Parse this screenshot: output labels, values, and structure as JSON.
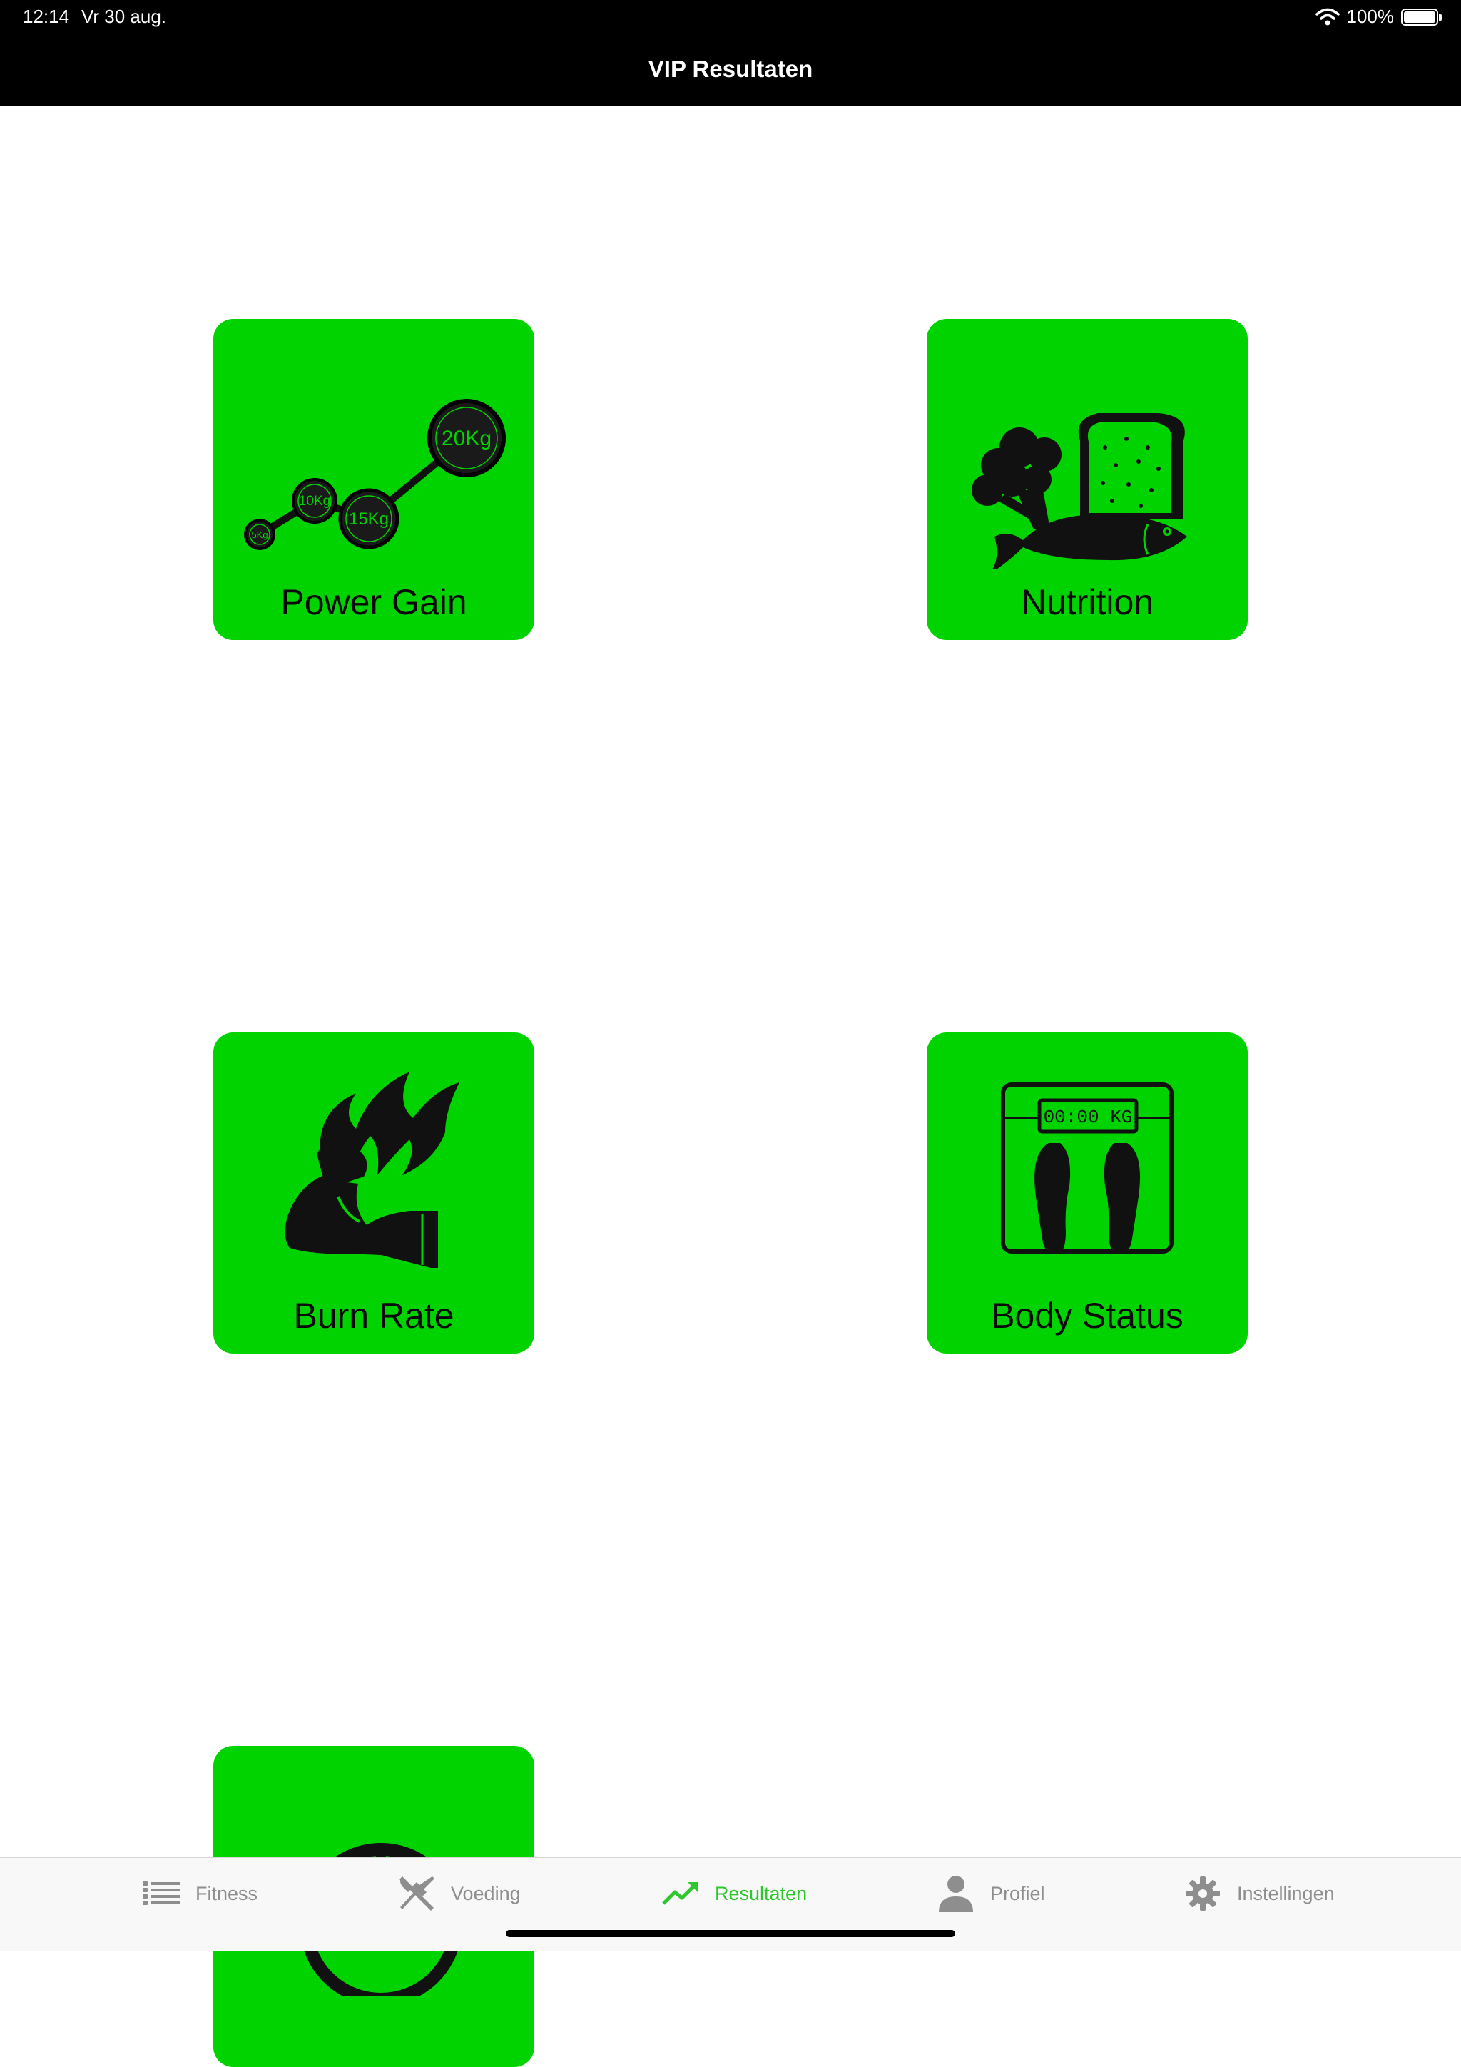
{
  "status_bar": {
    "time": "12:14",
    "date": "Vr 30 aug.",
    "battery_text": "100%",
    "battery_level": 1.0
  },
  "nav": {
    "title": "VIP Resultaten"
  },
  "tiles": [
    {
      "label": "Power Gain",
      "icon": "weight-progress-icon",
      "weights": [
        "5Kg",
        "10Kg",
        "15Kg",
        "20Kg"
      ]
    },
    {
      "label": "Nutrition",
      "icon": "food-icon"
    },
    {
      "label": "Burn Rate",
      "icon": "flaming-muscle-icon"
    },
    {
      "label": "Body Status",
      "icon": "scale-icon",
      "scale_display": "00:00 KG"
    },
    {
      "label": "",
      "icon": "clock-icon"
    }
  ],
  "tabbar": {
    "active": "Resultaten",
    "tabs": [
      {
        "label": "Fitness",
        "icon": "list-icon"
      },
      {
        "label": "Voeding",
        "icon": "fork-knife-icon"
      },
      {
        "label": "Resultaten",
        "icon": "trend-up-icon"
      },
      {
        "label": "Profiel",
        "icon": "person-icon"
      },
      {
        "label": "Instellingen",
        "icon": "gear-icon"
      }
    ]
  },
  "colors": {
    "tile": "#00d300",
    "tab_active": "#2ec82e",
    "tab_inactive": "#8e8e8e",
    "nav_bg": "#000000"
  }
}
